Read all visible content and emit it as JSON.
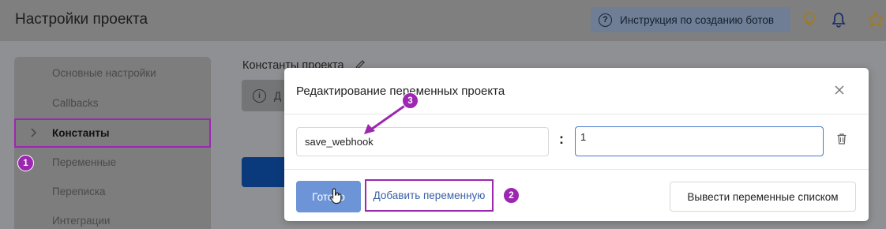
{
  "header": {
    "title": "Настройки проекта",
    "help_button": "Инструкция по созданию ботов",
    "icons": [
      "question-circle-icon",
      "lightbulb-icon",
      "bell-icon",
      "star-icon"
    ]
  },
  "sidebar": {
    "items": [
      {
        "label": "Основные настройки"
      },
      {
        "label": "Callbacks"
      },
      {
        "label": "Константы",
        "active": true
      },
      {
        "label": "Переменные"
      },
      {
        "label": "Переписка"
      },
      {
        "label": "Интеграции"
      }
    ]
  },
  "content": {
    "title": "Константы проекта",
    "info_text": "Д"
  },
  "modal": {
    "title": "Редактирование переменных проекта",
    "variable": {
      "name": "save_webhook",
      "separator": ":",
      "value": "1"
    },
    "buttons": {
      "done": "Готово",
      "add": "Добавить переменную",
      "list": "Вывести переменные списком"
    }
  },
  "annotations": {
    "step1": "1",
    "step2": "2",
    "step3": "3"
  },
  "colors": {
    "accent": "#9c27b0",
    "primary": "#6c94d6",
    "link": "#3a5fa8"
  }
}
